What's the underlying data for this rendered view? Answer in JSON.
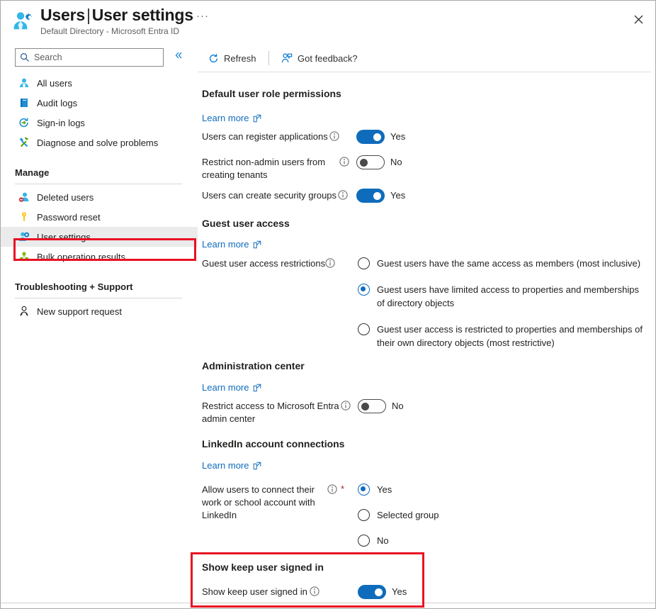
{
  "header": {
    "app_icon": "users-settings-icon",
    "title_main": "Users",
    "title_sep": "|",
    "title_sub": "User settings",
    "subtitle": "Default Directory - Microsoft Entra ID",
    "more_label": "···",
    "close_icon": "close-icon"
  },
  "sidebar": {
    "search": {
      "value": "",
      "placeholder": "Search",
      "icon": "search-icon"
    },
    "collapse_icon": "chevron-double-left-icon",
    "items": [
      {
        "label": "All users",
        "icon": "user-icon",
        "selected": false
      },
      {
        "label": "Audit logs",
        "icon": "book-icon",
        "selected": false
      },
      {
        "label": "Sign-in logs",
        "icon": "sign-in-icon",
        "selected": false
      },
      {
        "label": "Diagnose and solve problems",
        "icon": "wrench-icon",
        "selected": false
      }
    ],
    "group_manage": "Manage",
    "manage_items": [
      {
        "label": "Deleted users",
        "icon": "deleted-user-icon",
        "selected": false
      },
      {
        "label": "Password reset",
        "icon": "key-icon",
        "selected": false
      },
      {
        "label": "User settings",
        "icon": "users-settings-icon",
        "selected": true
      },
      {
        "label": "Bulk operation results",
        "icon": "bulk-operations-icon",
        "selected": false
      }
    ],
    "group_support": "Troubleshooting + Support",
    "support_items": [
      {
        "label": "New support request",
        "icon": "support-person-icon",
        "selected": false
      }
    ]
  },
  "toolbar": {
    "refresh_label": "Refresh",
    "refresh_icon": "refresh-icon",
    "feedback_label": "Got feedback?",
    "feedback_icon": "feedback-person-icon"
  },
  "learn_more_label": "Learn more",
  "sections": {
    "default_role": {
      "title": "Default user role permissions",
      "fields": [
        {
          "label": "Users can register applications",
          "value": "Yes",
          "on": true
        },
        {
          "label": "Restrict non-admin users from creating tenants",
          "value": "No",
          "on": false
        },
        {
          "label": "Users can create security groups",
          "value": "Yes",
          "on": true
        }
      ]
    },
    "guest_access": {
      "title": "Guest user access",
      "field_label": "Guest user access restrictions",
      "options": [
        {
          "label": "Guest users have the same access as members (most inclusive)",
          "checked": false
        },
        {
          "label": "Guest users have limited access to properties and memberships of directory objects",
          "checked": true
        },
        {
          "label": "Guest user access is restricted to properties and memberships of their own directory objects (most restrictive)",
          "checked": false
        }
      ]
    },
    "admin_center": {
      "title": "Administration center",
      "field_label": "Restrict access to Microsoft Entra admin center",
      "value": "No",
      "on": false
    },
    "linkedin": {
      "title": "LinkedIn account connections",
      "field_label": "Allow users to connect their work or school account with LinkedIn",
      "required_mark": "*",
      "options": [
        {
          "label": "Yes",
          "checked": true
        },
        {
          "label": "Selected group",
          "checked": false
        },
        {
          "label": "No",
          "checked": false
        }
      ]
    },
    "keep_signed_in": {
      "title": "Show keep user signed in",
      "field_label": "Show keep user signed in",
      "value": "Yes",
      "on": true
    }
  },
  "highlights": {
    "accent": "#e81123",
    "toggle_on": "#0f6cbd",
    "link": "#0f6cbd"
  }
}
